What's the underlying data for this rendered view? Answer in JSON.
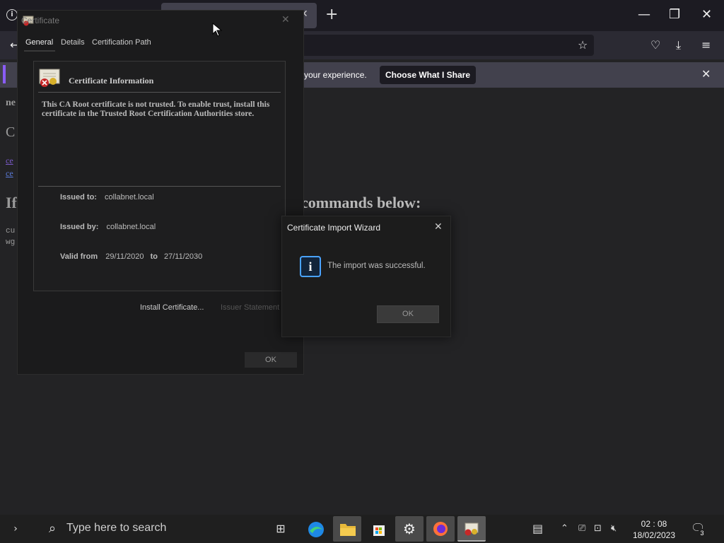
{
  "browser": {
    "notification_text": "your experience.",
    "notification_button": "Choose What I Share"
  },
  "page": {
    "frag_ne": "ne",
    "frag_c": "C",
    "frag_link1": "ce",
    "frag_link2": "ce",
    "frag_if": "If",
    "frag_cu": "cu",
    "frag_wg": "wg",
    "commands_heading": "commands below:"
  },
  "certificate": {
    "title": "Certificate",
    "tabs": [
      "General",
      "Details",
      "Certification Path"
    ],
    "info_title": "Certificate Information",
    "message": "This CA Root certificate is not trusted. To enable trust, install this certificate in the Trusted Root Certification Authorities store.",
    "issued_to_label": "Issued to:",
    "issued_to": "collabnet.local",
    "issued_by_label": "Issued by:",
    "issued_by": "collabnet.local",
    "valid_from_label": "Valid from",
    "valid_from": "29/11/2020",
    "to_label": "to",
    "valid_to": "27/11/2030",
    "install_button": "Install Certificate...",
    "issuer_button": "Issuer Statement",
    "ok_button": "OK"
  },
  "wizard": {
    "title": "Certificate Import Wizard",
    "message": "The import was successful.",
    "ok_button": "OK"
  },
  "taskbar": {
    "search_placeholder": "Type here to search",
    "time": "02 : 08",
    "date": "18/02/2023",
    "notification_count": "3"
  },
  "colors": {
    "dialog_bg": "#1b1b1c",
    "accent_blue": "#4aa3ff",
    "notification_bg": "#42414d"
  }
}
